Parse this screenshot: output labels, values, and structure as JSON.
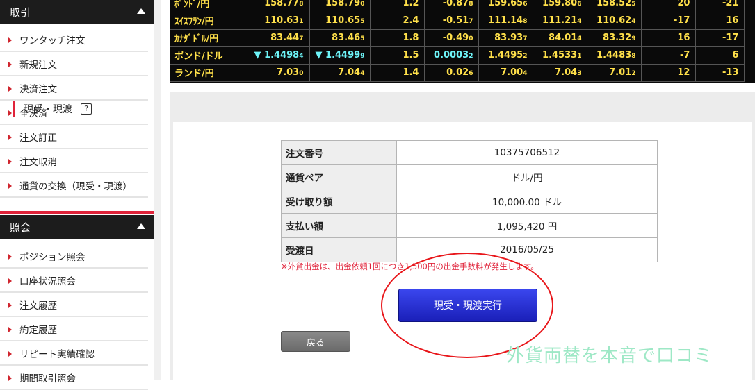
{
  "sidebar": {
    "sections": [
      {
        "title": "取引",
        "items": [
          "ワンタッチ注文",
          "新規注文",
          "決済注文",
          "全決済",
          "注文訂正",
          "注文取消",
          "通貨の交換（現受・現渡）"
        ]
      },
      {
        "title": "照会",
        "items": [
          "ポジション照会",
          "口座状況照会",
          "注文履歴",
          "約定履歴",
          "リピート実績確認",
          "期間取引照会"
        ]
      }
    ]
  },
  "rates": [
    {
      "pair": "ﾎﾟﾝﾄﾞ/円",
      "bid": "158.77",
      "bid_s": "8",
      "ask": "158.79",
      "ask_s": "0",
      "spread": "1.2",
      "chg": "-0.87",
      "chg_s": "8",
      "c1": "159.65",
      "c1_s": "6",
      "c2": "159.80",
      "c2_s": "6",
      "c3": "158.52",
      "c3_s": "5",
      "c4": "20",
      "c5": "-21"
    },
    {
      "pair": "ｽｲｽﾌﾗﾝ/円",
      "bid": "110.63",
      "bid_s": "1",
      "ask": "110.65",
      "ask_s": "5",
      "spread": "2.4",
      "chg": "-0.51",
      "chg_s": "7",
      "c1": "111.14",
      "c1_s": "8",
      "c2": "111.21",
      "c2_s": "4",
      "c3": "110.62",
      "c3_s": "4",
      "c4": "-17",
      "c5": "16"
    },
    {
      "pair": "ｶﾅﾀﾞﾄﾞﾙ/円",
      "bid": "83.44",
      "bid_s": "7",
      "ask": "83.46",
      "ask_s": "5",
      "spread": "1.8",
      "chg": "-0.49",
      "chg_s": "0",
      "c1": "83.93",
      "c1_s": "7",
      "c2": "84.01",
      "c2_s": "4",
      "c3": "83.32",
      "c3_s": "9",
      "c4": "16",
      "c5": "-17"
    },
    {
      "pair": "ポンド/ドル",
      "bid": "▼ 1.4498",
      "bid_s": "4",
      "ask": "▼ 1.4499",
      "ask_s": "9",
      "spread": "1.5",
      "chg": "0.0003",
      "chg_s": "2",
      "c1": "1.4495",
      "c1_s": "2",
      "c2": "1.4533",
      "c2_s": "1",
      "c3": "1.4483",
      "c3_s": "8",
      "c4": "-7",
      "c5": "6",
      "cyan": true
    },
    {
      "pair": "ランド/円",
      "bid": "7.03",
      "bid_s": "0",
      "ask": "7.04",
      "ask_s": "4",
      "spread": "1.4",
      "chg": "0.02",
      "chg_s": "6",
      "c1": "7.00",
      "c1_s": "4",
      "c2": "7.04",
      "c2_s": "3",
      "c3": "7.01",
      "c3_s": "2",
      "c4": "12",
      "c5": "-13"
    }
  ],
  "panel": {
    "title": "現受・現渡",
    "help_icon": "?",
    "rows": [
      {
        "label": "注文番号",
        "value": "10375706512"
      },
      {
        "label": "通貨ペア",
        "value": "ドル/円"
      },
      {
        "label": "受け取り額",
        "value": "10,000.00 ドル"
      },
      {
        "label": "支払い額",
        "value": "1,095,420 円"
      },
      {
        "label": "受渡日",
        "value": "2016/05/25"
      }
    ],
    "notice": "※外貨出金は、出金依頼1回につき1,500円の出金手数料が発生します。",
    "execute_label": "現受・現渡実行",
    "back_label": "戻る"
  },
  "watermark": "外貨両替を本音で口コミ",
  "colors": {
    "accent_red": "#e0233a",
    "rate_yellow": "#ffe04a",
    "rate_cyan": "#6ef4f8",
    "execute_blue": "#2a32d8"
  }
}
